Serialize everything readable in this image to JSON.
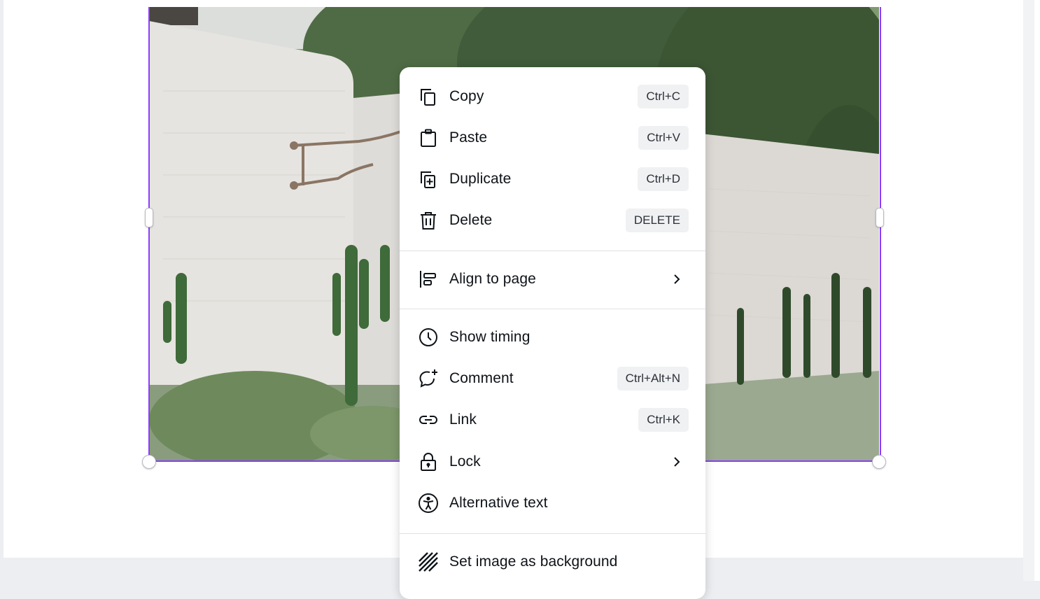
{
  "menu": {
    "items": [
      {
        "id": "copy",
        "label": "Copy",
        "shortcut": "Ctrl+C",
        "icon": "copy-icon"
      },
      {
        "id": "paste",
        "label": "Paste",
        "shortcut": "Ctrl+V",
        "icon": "paste-icon"
      },
      {
        "id": "duplicate",
        "label": "Duplicate",
        "shortcut": "Ctrl+D",
        "icon": "duplicate-icon"
      },
      {
        "id": "delete",
        "label": "Delete",
        "shortcut": "DELETE",
        "icon": "trash-icon"
      },
      {
        "id": "align",
        "label": "Align to page",
        "submenu": true,
        "icon": "align-left-icon"
      },
      {
        "id": "timing",
        "label": "Show timing",
        "icon": "clock-icon"
      },
      {
        "id": "comment",
        "label": "Comment",
        "shortcut": "Ctrl+Alt+N",
        "icon": "comment-add-icon"
      },
      {
        "id": "link",
        "label": "Link",
        "shortcut": "Ctrl+K",
        "icon": "link-icon"
      },
      {
        "id": "lock",
        "label": "Lock",
        "submenu": true,
        "icon": "lock-icon"
      },
      {
        "id": "alt",
        "label": "Alternative text",
        "icon": "accessibility-icon"
      },
      {
        "id": "background",
        "label": "Set image as background",
        "icon": "hatch-background-icon"
      }
    ]
  },
  "colors": {
    "selection": "#8b3dff",
    "menu_text": "#0e1318",
    "shortcut_bg": "#f0f1f3"
  }
}
